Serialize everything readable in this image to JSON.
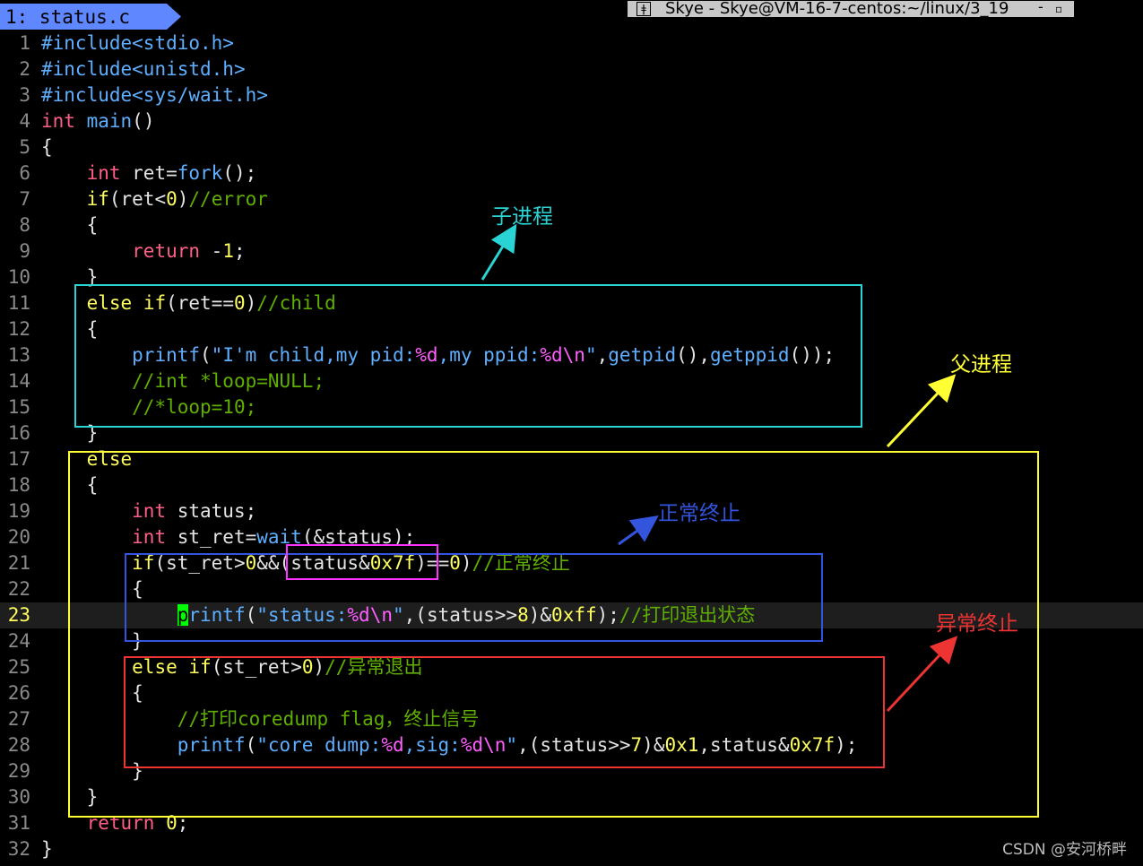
{
  "tab": {
    "label": "1: status.c"
  },
  "window": {
    "title": "Skye - Skye@VM-16-7-centos:~/linux/3_19",
    "min_glyph": "-",
    "restore_glyph": "▫"
  },
  "colors": {
    "child_box": "#2ad4d4",
    "parent_box": "#ffff33",
    "normal_box": "#3355dd",
    "abnormal_box": "#ee3333",
    "mask_box": "#ff33ff"
  },
  "code_lines": [
    {
      "n": "1"
    },
    {
      "n": "2"
    },
    {
      "n": "3"
    },
    {
      "n": "4"
    },
    {
      "n": "5"
    },
    {
      "n": "6"
    },
    {
      "n": "7"
    },
    {
      "n": "8"
    },
    {
      "n": "9"
    },
    {
      "n": "10"
    },
    {
      "n": "11"
    },
    {
      "n": "12"
    },
    {
      "n": "13"
    },
    {
      "n": "14"
    },
    {
      "n": "15"
    },
    {
      "n": "16"
    },
    {
      "n": "17"
    },
    {
      "n": "18"
    },
    {
      "n": "19"
    },
    {
      "n": "20"
    },
    {
      "n": "21"
    },
    {
      "n": "22"
    },
    {
      "n": "23"
    },
    {
      "n": "24"
    },
    {
      "n": "25"
    },
    {
      "n": "26"
    },
    {
      "n": "27"
    },
    {
      "n": "28"
    },
    {
      "n": "29"
    },
    {
      "n": "30"
    },
    {
      "n": "31"
    },
    {
      "n": "32"
    }
  ],
  "code": {
    "l1": [
      "#include",
      "<stdio.h>"
    ],
    "l2": [
      "#include",
      "<unistd.h>"
    ],
    "l3": [
      "#include",
      "<sys/wait.h>"
    ],
    "l4": [
      "int",
      " ",
      "main",
      "()"
    ],
    "l5": [
      "{"
    ],
    "l6": [
      "    ",
      "int",
      " ret=",
      "fork",
      "();"
    ],
    "l7": [
      "    ",
      "if",
      "(ret<",
      "0",
      ")",
      "//error"
    ],
    "l8": [
      "    {"
    ],
    "l9": [
      "        ",
      "return",
      " -",
      "1",
      ";"
    ],
    "l10": [
      "    }"
    ],
    "l11": [
      "    ",
      "else",
      " ",
      "if",
      "(ret==",
      "0",
      ")",
      "//child"
    ],
    "l12": [
      "    {"
    ],
    "l13": [
      "        ",
      "printf",
      "(",
      "\"I'm child,my pid:",
      "%d",
      ",my ppid:",
      "%d",
      "\\n",
      "\"",
      ",",
      "getpid",
      "(),",
      "getppid",
      "());"
    ],
    "l14": [
      "        ",
      "//int *loop=NULL;"
    ],
    "l15": [
      "        ",
      "//*loop=10;"
    ],
    "l16": [
      "    }"
    ],
    "l17": [
      "    ",
      "else"
    ],
    "l18": [
      "    {"
    ],
    "l19": [
      "        ",
      "int",
      " status;"
    ],
    "l20": [
      "        ",
      "int",
      " st_ret=",
      "wait",
      "(&status);"
    ],
    "l21": [
      "        ",
      "if",
      "(st_ret>",
      "0",
      "&&(status&",
      "0x7f",
      ")==",
      "0",
      ")",
      "//正常终止"
    ],
    "l22": [
      "        {"
    ],
    "l23": [
      "            ",
      "p",
      "rintf",
      "(",
      "\"status:",
      "%d",
      "\\n",
      "\"",
      ",(status>>",
      "8",
      ")&",
      "0xff",
      ");",
      "//打印退出状态"
    ],
    "l24": [
      "        }"
    ],
    "l25": [
      "        ",
      "else",
      " ",
      "if",
      "(st_ret>",
      "0",
      ")",
      "//异常退出"
    ],
    "l26": [
      "        {"
    ],
    "l27": [
      "            ",
      "//打印coredump flag，终止信号"
    ],
    "l28": [
      "            ",
      "printf",
      "(",
      "\"core dump:",
      "%d",
      ",sig:",
      "%d",
      "\\n",
      "\"",
      ",(status>>",
      "7",
      ")&",
      "0x1",
      ",status&",
      "0x7f",
      ");"
    ],
    "l29": [
      "        }"
    ],
    "l30": [
      "    }"
    ],
    "l31": [
      "    ",
      "return",
      " ",
      "0",
      ";"
    ],
    "l32": [
      "}"
    ]
  },
  "annotations": {
    "child": "子进程",
    "parent": "父进程",
    "normal": "正常终止",
    "abnormal": "异常终止"
  },
  "watermark": "CSDN @安河桥畔"
}
